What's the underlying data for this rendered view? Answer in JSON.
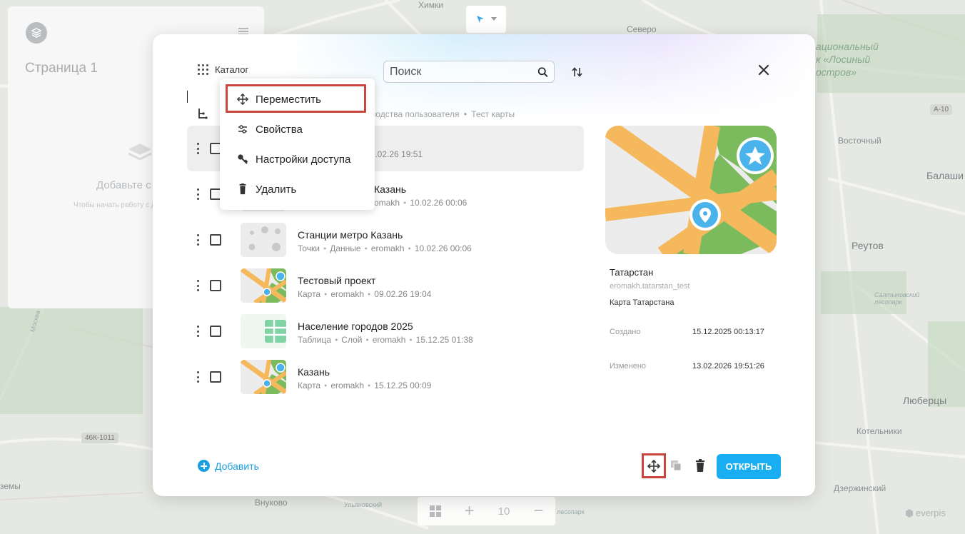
{
  "map": {
    "labels": {
      "khimki": "Химки",
      "severo": "Северо",
      "park": "ациональный\nк «Лосиный\nостров»",
      "a10": "А-10",
      "vostochny": "Восточный",
      "balashikha": "Балаши",
      "reutov": "Реутов",
      "saltykovsky": "Салтыковский\nлесопарк",
      "lyubertsy": "Люберцы",
      "kotelniki": "Котельники",
      "dzerzhinsky": "Дзержинский",
      "vnukovo": "Внуково",
      "mkad": "Москва",
      "road_46k": "46К-1011",
      "zemy": "земы",
      "ulyanovsky": "Ульяновский",
      "lesopark_small": "лесопарк"
    }
  },
  "sidebar": {
    "page_title": "Страница 1",
    "empty_title": "Добавьте с",
    "empty_hint": "Чтобы начать работу с добавьте слои"
  },
  "bottom_bar": {
    "zoom": "10"
  },
  "brand": "everpis",
  "modal": {
    "catalog_label": "Каталог",
    "search_placeholder": "Поиск",
    "breadcrumb": [
      "ководства пользователя",
      "Тест карты"
    ],
    "items": [
      {
        "name": "",
        "meta": [
          "13.02.26 19:51"
        ],
        "thumb": "map",
        "selected": true
      },
      {
        "name": "Казань",
        "meta": [
          "omakh",
          "10.02.26 00:06"
        ],
        "thumb": "points"
      },
      {
        "name": "Станции метро Казань",
        "meta": [
          "Точки",
          "Данные",
          "eromakh",
          "10.02.26 00:06"
        ],
        "thumb": "points"
      },
      {
        "name": "Тестовый проект",
        "meta": [
          "Карта",
          "eromakh",
          "09.02.26 19:04"
        ],
        "thumb": "map"
      },
      {
        "name": "Население городов 2025",
        "meta": [
          "Таблица",
          "Слой",
          "eromakh",
          "15.12.25 01:38"
        ],
        "thumb": "table"
      },
      {
        "name": "Казань",
        "meta": [
          "Карта",
          "eromakh",
          "15.12.25 00:09"
        ],
        "thumb": "map"
      }
    ],
    "context_menu": {
      "move": "Переместить",
      "properties": "Свойства",
      "access": "Настройки доступа",
      "delete": "Удалить"
    },
    "preview": {
      "title": "Татарстан",
      "id": "eromakh.tatarstan_test",
      "description": "Карта Татарстана",
      "created_label": "Создано",
      "created_value": "15.12.2025 00:13:17",
      "modified_label": "Изменено",
      "modified_value": "13.02.2026 19:51:26"
    },
    "add_label": "Добавить",
    "open_label": "ОТКРЫТЬ"
  },
  "colors": {
    "accent": "#19aef2",
    "highlight": "#c9453e",
    "map_road": "#f5b85c",
    "map_green": "#79b85e",
    "pin_blue": "#4ab3ec"
  }
}
